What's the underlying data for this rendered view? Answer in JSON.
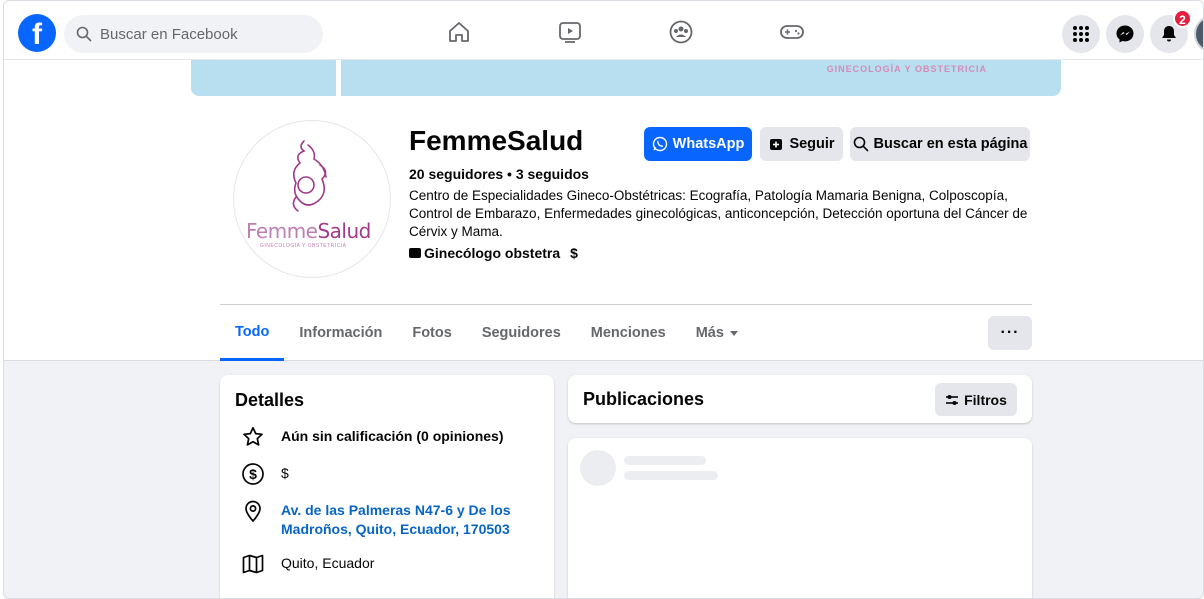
{
  "topbar": {
    "search_placeholder": "Buscar en Facebook",
    "notification_count": "2"
  },
  "cover": {
    "text": "GINECOLOGÍA Y OBSTETRICIA",
    "color": "#b8dff0"
  },
  "profile": {
    "logo_name_part1": "Femme",
    "logo_name_part2": "Salud",
    "logo_subtitle": "GINECOLOGÍA Y OBSTETRICIA",
    "name": "FemmeSalud",
    "stats": "20 seguidores • 3 seguidos",
    "bio": "Centro de Especialidades Gineco-Obstétricas: Ecografía, Patología Mamaria Benigna, Colposcopía, Control de Embarazo, Enfermedades ginecológicas, anticoncepción, Detección oportuna del Cáncer de Cérvix y Mama.",
    "category": "Ginecólogo obstetra",
    "price": "$"
  },
  "actions": {
    "whatsapp": "WhatsApp",
    "follow": "Seguir",
    "search_page": "Buscar en esta página"
  },
  "tabs": [
    {
      "label": "Todo",
      "active": true
    },
    {
      "label": "Información"
    },
    {
      "label": "Fotos"
    },
    {
      "label": "Seguidores"
    },
    {
      "label": "Menciones"
    },
    {
      "label": "Más"
    }
  ],
  "more_label": "···",
  "details": {
    "title": "Detalles",
    "rating": "Aún sin calificación (0 opiniones)",
    "price": "$",
    "address": "Av. de las Palmeras N47-6 y De los Madroños, Quito, Ecuador, 170503",
    "city": "Quito, Ecuador"
  },
  "posts": {
    "title": "Publicaciones",
    "filters": "Filtros"
  },
  "colors": {
    "brand_blue": "#0866ff",
    "link_blue": "#0865c6",
    "badge_red": "#e41e3f",
    "logo_pink": "#a13a8a"
  }
}
